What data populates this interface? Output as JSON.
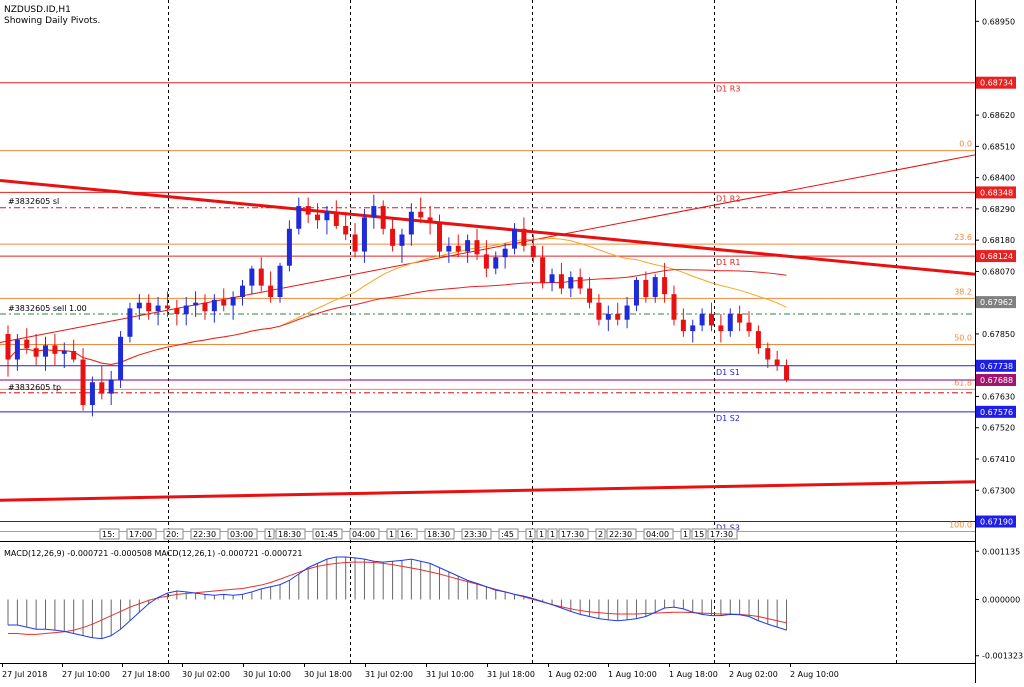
{
  "header": {
    "symbol": "NZDUSD.ID,H1",
    "subtitle": "Showing Daily Pivots."
  },
  "colors": {
    "bull": "#1f2bd6",
    "bear": "#e81010",
    "pivot_red": "#e82020",
    "pivot_blue": "#1e1ee6",
    "fib": "#f08a3c",
    "trend": "#e81010",
    "ma": "#f5a623",
    "macd_signal": "#e83030",
    "macd_main": "#1e3ce8",
    "grid": "#000000"
  },
  "price_axis": {
    "ticks": [
      "0.68950",
      "0.68620",
      "0.68510",
      "0.68400",
      "0.68290",
      "0.68180",
      "0.68070",
      "0.67850",
      "0.67630",
      "0.67520",
      "0.67410",
      "0.67300"
    ],
    "tick_values": [
      0.6895,
      0.6862,
      0.6851,
      0.684,
      0.6829,
      0.6818,
      0.6807,
      0.6785,
      0.6763,
      0.6752,
      0.6741,
      0.673
    ],
    "range": [
      0.67125,
      0.69025
    ]
  },
  "levels": [
    {
      "name": "R3",
      "price": 0.68734,
      "label": "D1 R3",
      "tag": "0.68734",
      "kind": "red"
    },
    {
      "name": "R2",
      "price": 0.68348,
      "label": "D1 R2",
      "tag": "0.68348",
      "kind": "red"
    },
    {
      "name": "R1",
      "price": 0.68124,
      "label": "D1 R1",
      "tag": "0.68124",
      "kind": "red"
    },
    {
      "name": "S1",
      "price": 0.67738,
      "label": "D1 S1",
      "tag": "0.67738",
      "kind": "blue"
    },
    {
      "name": "S2",
      "price": 0.67576,
      "label": "D1 S2",
      "tag": "0.67576",
      "kind": "blue"
    },
    {
      "name": "S3",
      "price": 0.6719,
      "label": "D1 S3",
      "tag": "0.67190",
      "kind": "blue"
    }
  ],
  "fib_levels": [
    {
      "label": "0.0",
      "price": 0.68495
    },
    {
      "label": "23.6",
      "price": 0.68166
    },
    {
      "label": "38.2",
      "price": 0.67975
    },
    {
      "label": "50.0",
      "price": 0.67813
    },
    {
      "label": "61.8",
      "price": 0.67655
    },
    {
      "label": "100.0",
      "price": 0.67155
    }
  ],
  "orders": {
    "sl": {
      "label": "#3832605 sl",
      "price": 0.68294
    },
    "entry": {
      "label": "#3832605 sell 1.00",
      "price": 0.6792
    },
    "tp": {
      "label": "#3832605 tp",
      "price": 0.67643
    }
  },
  "current_price": {
    "tag": "0.67688",
    "price": 0.67688
  },
  "level_tag_798": {
    "tag": "0.67962",
    "price": 0.67962
  },
  "chart_data": {
    "type": "candlestick",
    "symbol": "NZDUSD.ID",
    "timeframe": "H1",
    "candles": [
      [
        0.6785,
        0.6788,
        0.677,
        0.6776
      ],
      [
        0.6776,
        0.6785,
        0.6772,
        0.6783
      ],
      [
        0.6783,
        0.6787,
        0.6778,
        0.678
      ],
      [
        0.678,
        0.6785,
        0.6774,
        0.6777
      ],
      [
        0.6777,
        0.6784,
        0.6772,
        0.6781
      ],
      [
        0.6781,
        0.6785,
        0.6774,
        0.6778
      ],
      [
        0.6778,
        0.6782,
        0.6773,
        0.6779
      ],
      [
        0.6779,
        0.6783,
        0.6775,
        0.6776
      ],
      [
        0.6776,
        0.678,
        0.6758,
        0.676
      ],
      [
        0.676,
        0.677,
        0.6756,
        0.6768
      ],
      [
        0.6768,
        0.6774,
        0.6762,
        0.6764
      ],
      [
        0.6764,
        0.6772,
        0.676,
        0.6769
      ],
      [
        0.6769,
        0.6786,
        0.6766,
        0.6784
      ],
      [
        0.6784,
        0.6796,
        0.6782,
        0.6794
      ],
      [
        0.6794,
        0.6799,
        0.679,
        0.6796
      ],
      [
        0.6796,
        0.6799,
        0.679,
        0.6793
      ],
      [
        0.6793,
        0.6798,
        0.6788,
        0.6795
      ],
      [
        0.6795,
        0.68,
        0.6791,
        0.6794
      ],
      [
        0.6794,
        0.6797,
        0.6788,
        0.6792
      ],
      [
        0.6792,
        0.6798,
        0.6788,
        0.6795
      ],
      [
        0.6795,
        0.68,
        0.6791,
        0.6796
      ],
      [
        0.6796,
        0.6799,
        0.679,
        0.6793
      ],
      [
        0.6793,
        0.6799,
        0.6789,
        0.6797
      ],
      [
        0.6797,
        0.6801,
        0.6793,
        0.6795
      ],
      [
        0.6795,
        0.68,
        0.679,
        0.6798
      ],
      [
        0.6798,
        0.6804,
        0.6795,
        0.6802
      ],
      [
        0.6802,
        0.6809,
        0.6799,
        0.6808
      ],
      [
        0.6808,
        0.6812,
        0.68,
        0.6802
      ],
      [
        0.6802,
        0.6807,
        0.6796,
        0.6798
      ],
      [
        0.6798,
        0.681,
        0.6796,
        0.6809
      ],
      [
        0.6809,
        0.6825,
        0.6807,
        0.6822
      ],
      [
        0.6822,
        0.6833,
        0.682,
        0.683
      ],
      [
        0.683,
        0.6833,
        0.6824,
        0.6827
      ],
      [
        0.6827,
        0.6831,
        0.6822,
        0.6825
      ],
      [
        0.6825,
        0.683,
        0.682,
        0.6828
      ],
      [
        0.6828,
        0.6832,
        0.6822,
        0.6823
      ],
      [
        0.6823,
        0.6828,
        0.6818,
        0.682
      ],
      [
        0.682,
        0.6824,
        0.6812,
        0.6814
      ],
      [
        0.6814,
        0.6829,
        0.681,
        0.6826
      ],
      [
        0.6826,
        0.6834,
        0.6822,
        0.683
      ],
      [
        0.683,
        0.6832,
        0.682,
        0.6822
      ],
      [
        0.6822,
        0.6826,
        0.6814,
        0.6816
      ],
      [
        0.6816,
        0.6822,
        0.681,
        0.682
      ],
      [
        0.682,
        0.6831,
        0.6816,
        0.6828
      ],
      [
        0.6828,
        0.6833,
        0.6824,
        0.6826
      ],
      [
        0.6826,
        0.683,
        0.682,
        0.6824
      ],
      [
        0.6824,
        0.6827,
        0.6812,
        0.6814
      ],
      [
        0.6814,
        0.6819,
        0.681,
        0.6816
      ],
      [
        0.6816,
        0.682,
        0.6812,
        0.6814
      ],
      [
        0.6814,
        0.682,
        0.681,
        0.6818
      ],
      [
        0.6818,
        0.6822,
        0.6811,
        0.6813
      ],
      [
        0.6813,
        0.6818,
        0.6805,
        0.6808
      ],
      [
        0.6808,
        0.6814,
        0.6806,
        0.6812
      ],
      [
        0.6812,
        0.6817,
        0.6808,
        0.6815
      ],
      [
        0.6815,
        0.6824,
        0.6813,
        0.6822
      ],
      [
        0.6822,
        0.6826,
        0.6814,
        0.6816
      ],
      [
        0.6816,
        0.682,
        0.681,
        0.6812
      ],
      [
        0.6812,
        0.6816,
        0.6801,
        0.6803
      ],
      [
        0.6803,
        0.6808,
        0.68,
        0.6806
      ],
      [
        0.6806,
        0.681,
        0.6799,
        0.6801
      ],
      [
        0.6801,
        0.6807,
        0.6798,
        0.6805
      ],
      [
        0.6805,
        0.6808,
        0.6799,
        0.6801
      ],
      [
        0.6801,
        0.6805,
        0.6794,
        0.6796
      ],
      [
        0.6796,
        0.6799,
        0.6788,
        0.679
      ],
      [
        0.679,
        0.6795,
        0.6786,
        0.6792
      ],
      [
        0.6792,
        0.6796,
        0.6788,
        0.679
      ],
      [
        0.679,
        0.6798,
        0.6787,
        0.6795
      ],
      [
        0.6795,
        0.6805,
        0.6793,
        0.6804
      ],
      [
        0.6804,
        0.6807,
        0.6796,
        0.6798
      ],
      [
        0.6798,
        0.6806,
        0.6796,
        0.6805
      ],
      [
        0.6805,
        0.681,
        0.6796,
        0.6799
      ],
      [
        0.6799,
        0.6802,
        0.6788,
        0.679
      ],
      [
        0.679,
        0.6794,
        0.6784,
        0.6786
      ],
      [
        0.6786,
        0.679,
        0.6782,
        0.6788
      ],
      [
        0.6788,
        0.6794,
        0.6786,
        0.6792
      ],
      [
        0.6792,
        0.6796,
        0.6786,
        0.6788
      ],
      [
        0.6788,
        0.6792,
        0.6782,
        0.6786
      ],
      [
        0.6786,
        0.6794,
        0.6784,
        0.6792
      ],
      [
        0.6792,
        0.6795,
        0.6786,
        0.6789
      ],
      [
        0.6789,
        0.6793,
        0.6784,
        0.6786
      ],
      [
        0.6786,
        0.6788,
        0.6778,
        0.678
      ],
      [
        0.678,
        0.6782,
        0.6773,
        0.6776
      ],
      [
        0.6776,
        0.6779,
        0.6772,
        0.6774
      ],
      [
        0.6774,
        0.6776,
        0.6768,
        0.6769
      ]
    ],
    "trendlines": [
      {
        "from": [
          0,
          0.6839
        ],
        "to": [
          1,
          0.6806
        ]
      },
      {
        "from": [
          0,
          0.67265
        ],
        "to": [
          1,
          0.6733
        ]
      },
      {
        "from": [
          0,
          0.6782
        ],
        "to": [
          1,
          0.6848
        ]
      }
    ]
  },
  "time_axis": {
    "labels": [
      "27 Jul 2018",
      "27 Jul 10:00",
      "27 Jul 18:00",
      "30 Jul 02:00",
      "30 Jul 10:00",
      "30 Jul 18:00",
      "31 Jul 02:00",
      "31 Jul 10:00",
      "31 Jul 18:00",
      "1 Aug 02:00",
      "1 Aug 10:00",
      "1 Aug 18:00",
      "2 Aug 02:00",
      "2 Aug 10:00"
    ]
  },
  "session_tags": [
    "15:",
    "17:00",
    "20:",
    "22:30",
    "03:00",
    "1",
    "18:30",
    "01:45",
    "04:00",
    "1",
    "16:",
    "18:30",
    "23:30",
    ":45",
    "1",
    "1",
    "1",
    "17:30",
    "2",
    "22:30",
    "04:00",
    "1",
    "15",
    "17:30"
  ],
  "macd": {
    "label": "MACD(12,26,9) -0.000721 -0.000508 MACD(12,26,1) -0.000721 -0.000721",
    "ticks": [
      "0.001135",
      "0.000000",
      "-0.001323"
    ],
    "tick_values": [
      0.001135,
      0.0,
      -0.001323
    ],
    "histogram": [
      -0.0006,
      -0.0006,
      -0.00065,
      -0.0007,
      -0.0007,
      -0.00072,
      -0.00075,
      -0.0008,
      -0.00085,
      -0.0009,
      -0.00092,
      -0.00085,
      -0.0007,
      -0.0005,
      -0.0003,
      -0.0001,
      5e-05,
      0.00015,
      0.0002,
      0.00018,
      0.00015,
      0.00012,
      0.0001,
      0.00012,
      0.0001,
      0.00012,
      0.00018,
      0.00025,
      0.0003,
      0.00035,
      0.00045,
      0.0006,
      0.00075,
      0.00085,
      0.00095,
      0.001,
      0.001,
      0.00098,
      0.00095,
      0.0009,
      0.00088,
      0.0009,
      0.00092,
      0.00095,
      0.0009,
      0.00085,
      0.00075,
      0.00065,
      0.00055,
      0.00045,
      0.00038,
      0.0003,
      0.00022,
      0.00018,
      0.00012,
      8e-05,
      2e-05,
      -5e-05,
      -0.00012,
      -0.0002,
      -0.00028,
      -0.00035,
      -0.0004,
      -0.00045,
      -0.00048,
      -0.0005,
      -0.00048,
      -0.00045,
      -0.0004,
      -0.0003,
      -0.0002,
      -0.00018,
      -0.00022,
      -0.0003,
      -0.00035,
      -0.00038,
      -0.00038,
      -0.00035,
      -0.00036,
      -0.0004,
      -0.0005,
      -0.00058,
      -0.00065,
      -0.00072
    ],
    "signal": [
      -0.0008,
      -0.0008,
      -0.00082,
      -0.00082,
      -0.0008,
      -0.00078,
      -0.00076,
      -0.00072,
      -0.00066,
      -0.00058,
      -0.00048,
      -0.00038,
      -0.00028,
      -0.00018,
      -0.0001,
      -2e-05,
      4e-05,
      8e-05,
      0.00012,
      0.00014,
      0.00016,
      0.00018,
      0.0002,
      0.00022,
      0.00024,
      0.00026,
      0.0003,
      0.00034,
      0.0004,
      0.00048,
      0.00056,
      0.00064,
      0.00072,
      0.00078,
      0.00082,
      0.00085,
      0.00087,
      0.00088,
      0.00088,
      0.00087,
      0.00085,
      0.00082,
      0.00078,
      0.00074,
      0.0007,
      0.00065,
      0.0006,
      0.00054,
      0.00048,
      0.00042,
      0.00036,
      0.0003,
      0.00024,
      0.00018,
      0.00012,
      6e-05,
      0.0,
      -6e-05,
      -0.00012,
      -0.00017,
      -0.00022,
      -0.00026,
      -0.00029,
      -0.00031,
      -0.00033,
      -0.00034,
      -0.00034,
      -0.00034,
      -0.00033,
      -0.00032,
      -0.00031,
      -0.0003,
      -0.0003,
      -0.00031,
      -0.00032,
      -0.00033,
      -0.00034,
      -0.00034,
      -0.00035,
      -0.00037,
      -0.0004,
      -0.00045,
      -0.0005,
      -0.00055
    ]
  }
}
